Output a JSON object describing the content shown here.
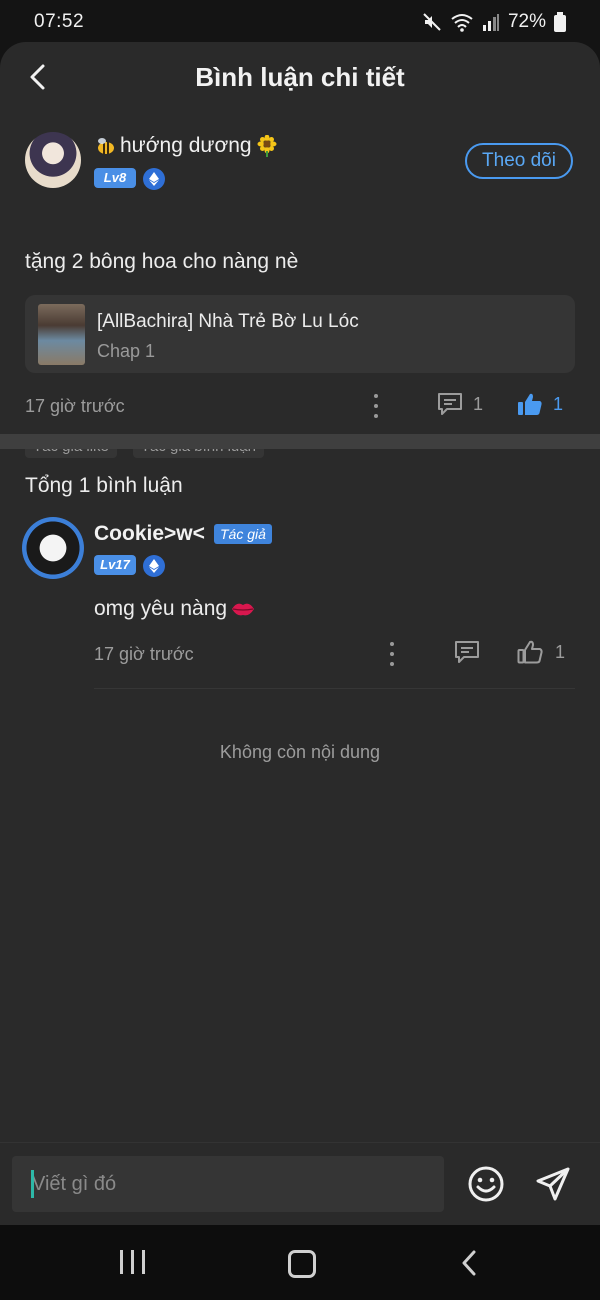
{
  "status_bar": {
    "time": "07:52",
    "battery": "72%"
  },
  "header": {
    "title": "Bình luận chi tiết"
  },
  "post": {
    "author_name": "hướng dương",
    "level": "Lv8",
    "follow_label": "Theo dõi",
    "content": "tặng 2 bông hoa cho nàng nè",
    "chapter": {
      "title": "[AllBachira] Nhà Trẻ Bờ Lu Lóc",
      "sub": "Chap 1"
    },
    "time": "17 giờ trước",
    "comment_count": "1",
    "like_count": "1",
    "tags": [
      "Tác giả like",
      "Tác giả bình luận"
    ]
  },
  "replies_header": "Tổng 1 bình luận",
  "reply": {
    "name": "Cookie>w<",
    "author_tag": "Tác giả",
    "level": "Lv17",
    "content": "omg yêu nàng",
    "time": "17 giờ trước",
    "like_count": "1"
  },
  "no_more": "Không còn nội dung",
  "input": {
    "placeholder": "Viết gì đó"
  },
  "colors": {
    "accent": "#4a9af0",
    "background": "#2a2a2a",
    "card": "#353535"
  }
}
